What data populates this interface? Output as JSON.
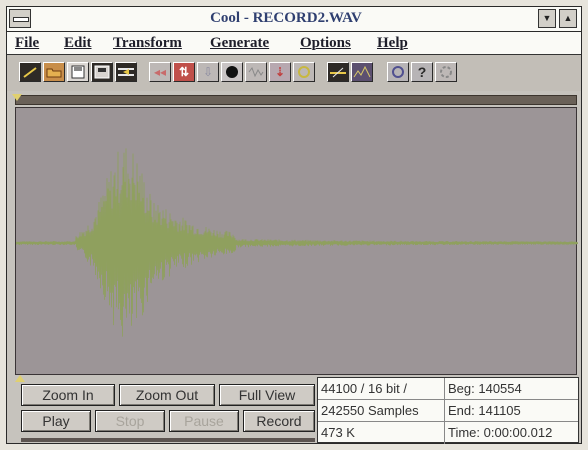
{
  "window": {
    "title": "Cool - RECORD2.WAV"
  },
  "menus": [
    "File",
    "Edit",
    "Transform",
    "Generate",
    "Options",
    "Help"
  ],
  "toolbar": {
    "icons": [
      "new-icon",
      "open-icon",
      "save-icon",
      "save-as-icon",
      "mix-icon",
      "reverse-icon",
      "invert-icon",
      "amplify-icon",
      "record-icon",
      "noise-icon",
      "pitch-icon",
      "timer-icon",
      "cue-icon",
      "spectrum-icon",
      "loop-icon",
      "help-icon",
      "settings-icon"
    ]
  },
  "controls": {
    "zoom_in": "Zoom In",
    "zoom_out": "Zoom Out",
    "full_view": "Full View",
    "play": "Play",
    "stop": "Stop",
    "pause": "Pause",
    "record": "Record"
  },
  "status": {
    "format": "44100 / 16 bit /",
    "samples": "242550 Samples",
    "size": "473 K",
    "begin": "Beg: 140554",
    "end": "End: 141105",
    "time": "Time: 0:00:00.012"
  },
  "colors": {
    "waveform": "#8fa05e",
    "title_text": "#2f3f70"
  }
}
